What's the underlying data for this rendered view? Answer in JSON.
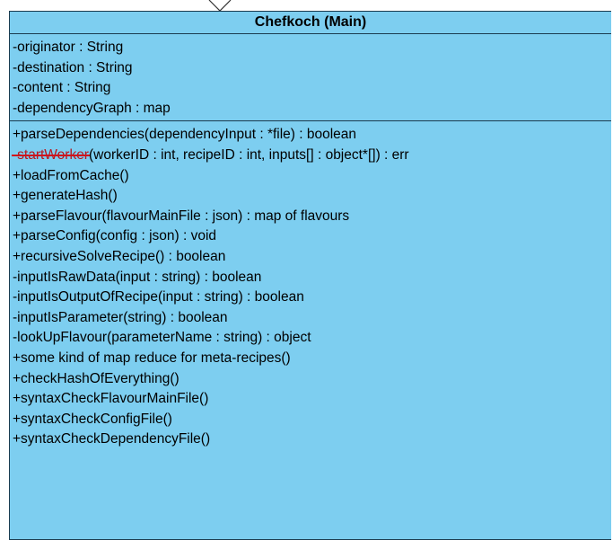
{
  "uml_class": {
    "title": "Chefkoch (Main)",
    "attributes": [
      "-originator : String",
      "-destination : String",
      "-content : String",
      "-dependencyGraph : map"
    ],
    "operations": [
      "+parseDependencies(dependencyInput : *file) : boolean",
      {
        "struck": "-startWorker",
        "rest": "(workerID : int, recipeID : int, inputs[] : object*[]) : err"
      },
      "+loadFromCache()",
      "+generateHash()",
      "+parseFlavour(flavourMainFile : json) : map of flavours",
      "+parseConfig(config : json) : void",
      "+recursiveSolveRecipe() : boolean",
      "-inputIsRawData(input : string) : boolean",
      "-inputIsOutputOfRecipe(input : string) : boolean",
      "-inputIsParameter(string) : boolean",
      "-lookUpFlavour(parameterName : string) : object",
      "+some kind of map reduce for meta-recipes()",
      "+checkHashOfEverything()",
      "+syntaxCheckFlavourMainFile()",
      "+syntaxCheckConfigFile()",
      "+syntaxCheckDependencyFile()"
    ]
  },
  "colors": {
    "class_fill": "#7dcef0",
    "border": "#1b3b4f",
    "strike": "#d0121b"
  },
  "icons": {
    "generalization_arrow": "hollow-triangle-arrowhead"
  }
}
